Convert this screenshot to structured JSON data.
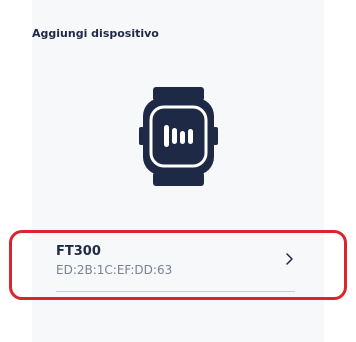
{
  "screen": {
    "title": "Aggiungi dispositivo"
  },
  "device": {
    "name": "FT300",
    "mac": "ED:2B:1C:EF:DD:63",
    "icon": "smartwatch-icon",
    "chevron_icon": "chevron-right-icon"
  },
  "colors": {
    "primary": "#1e2a45",
    "secondary_text": "#7b8193",
    "highlight": "#d9262e",
    "background": "#f7f8fa"
  }
}
